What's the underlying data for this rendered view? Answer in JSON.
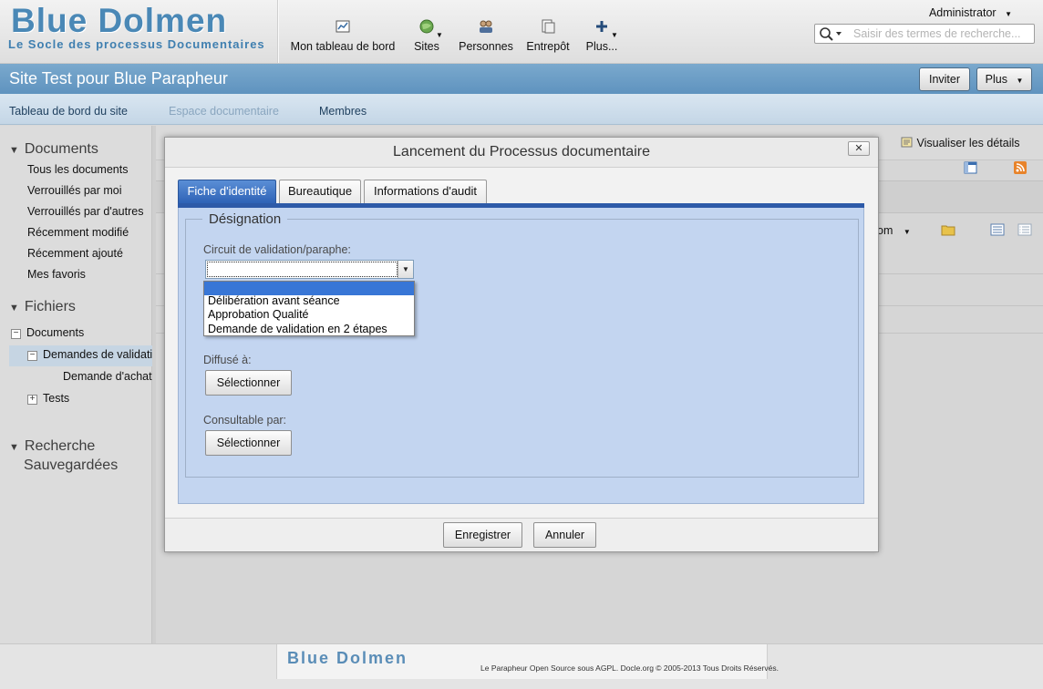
{
  "logo": {
    "title": "Blue Dolmen",
    "subtitle": "Le Socle des processus Documentaires"
  },
  "nav": {
    "items": [
      {
        "label": "Mon tableau de bord",
        "icon": "dashboard-icon"
      },
      {
        "label": "Sites",
        "icon": "globe-icon"
      },
      {
        "label": "Personnes",
        "icon": "people-icon"
      },
      {
        "label": "Entrepôt",
        "icon": "repository-icon"
      },
      {
        "label": "Plus...",
        "icon": "plus-icon"
      }
    ]
  },
  "user": {
    "name": "Administrator"
  },
  "search": {
    "placeholder": "Saisir des termes de recherche..."
  },
  "site": {
    "title": "Site Test pour Blue Parapheur",
    "invite_label": "Inviter",
    "more_label": "Plus"
  },
  "subnav": {
    "items": [
      "Tableau de bord du site",
      "Espace documentaire",
      "Membres"
    ]
  },
  "sidebar": {
    "documents_title": "Documents",
    "filters": [
      "Tous les documents",
      "Verrouillés par moi",
      "Verrouillés par d'autres",
      "Récemment modifié",
      "Récemment ajouté",
      "Mes favoris"
    ],
    "files_title": "Fichiers",
    "tree": [
      "Documents",
      "Demandes de validation",
      "Demande d'achat",
      "Tests"
    ],
    "saved_search_title_1": "Recherche",
    "saved_search_title_2": "Sauvegardées"
  },
  "main": {
    "details_label": "Visualiser les détails",
    "sort_fragment": "om"
  },
  "modal": {
    "title": "Lancement du Processus documentaire",
    "close_label": "✕",
    "tabs": [
      "Fiche d'identité",
      "Bureautique",
      "Informations d'audit"
    ],
    "legend": "Désignation",
    "circuit_label": "Circuit de validation/paraphe:",
    "options": [
      "",
      "Délibération avant séance",
      "Approbation Qualité",
      "Demande de validation en 2 étapes"
    ],
    "diffuse_label": "Diffusé à:",
    "consultable_label": "Consultable par:",
    "select_button_label": "Sélectionner",
    "save_label": "Enregistrer",
    "cancel_label": "Annuler"
  },
  "footer": {
    "logo": "Blue Dolmen",
    "copyright": "Le Parapheur Open Source sous AGPL. Docle.org © 2005-2013 Tous Droits Réservés."
  }
}
